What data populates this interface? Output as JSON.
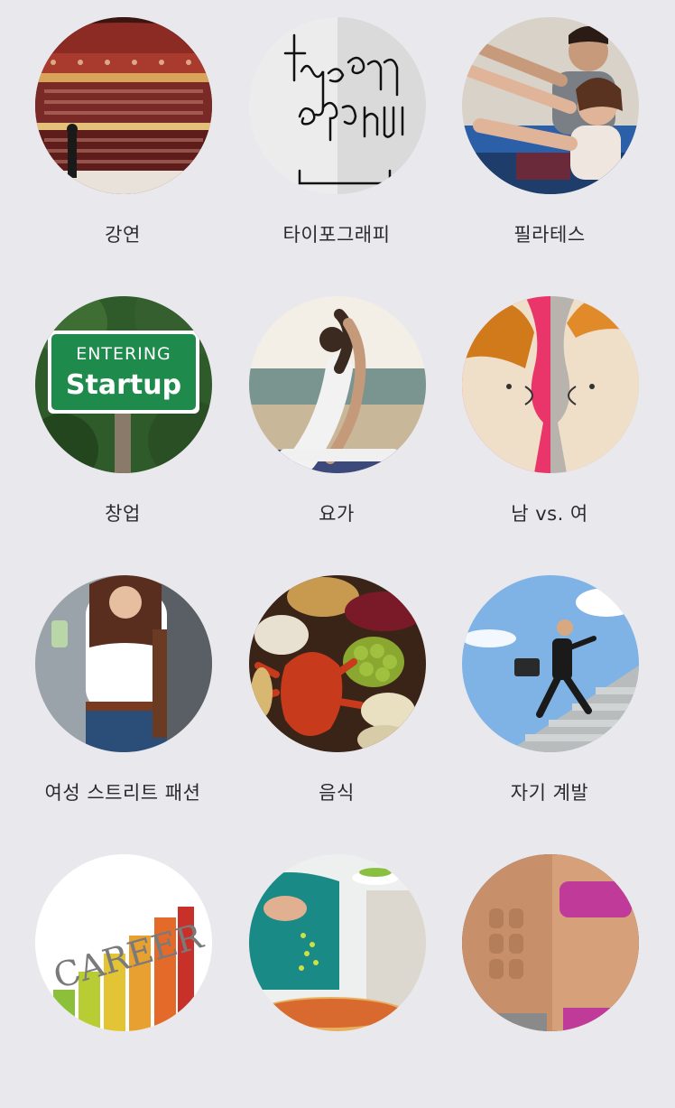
{
  "categories": [
    {
      "label": "강연",
      "icon": "lecture-hall-photo"
    },
    {
      "label": "타이포그래피",
      "icon": "typography-photo"
    },
    {
      "label": "필라테스",
      "icon": "pilates-photo"
    },
    {
      "label": "창업",
      "icon": "startup-sign-photo",
      "sign_top": "ENTERING",
      "sign_main": "Startup"
    },
    {
      "label": "요가",
      "icon": "yoga-photo"
    },
    {
      "label": "남 vs. 여",
      "icon": "man-vs-woman-illustration"
    },
    {
      "label": "여성 스트리트 패션",
      "icon": "street-fashion-photo"
    },
    {
      "label": "음식",
      "icon": "food-photo"
    },
    {
      "label": "자기 계발",
      "icon": "self-development-photo"
    },
    {
      "label": "",
      "icon": "career-chart-photo",
      "chart_word": "CAREER"
    },
    {
      "label": "",
      "icon": "cooking-photo"
    },
    {
      "label": "",
      "icon": "fitness-photo"
    }
  ]
}
